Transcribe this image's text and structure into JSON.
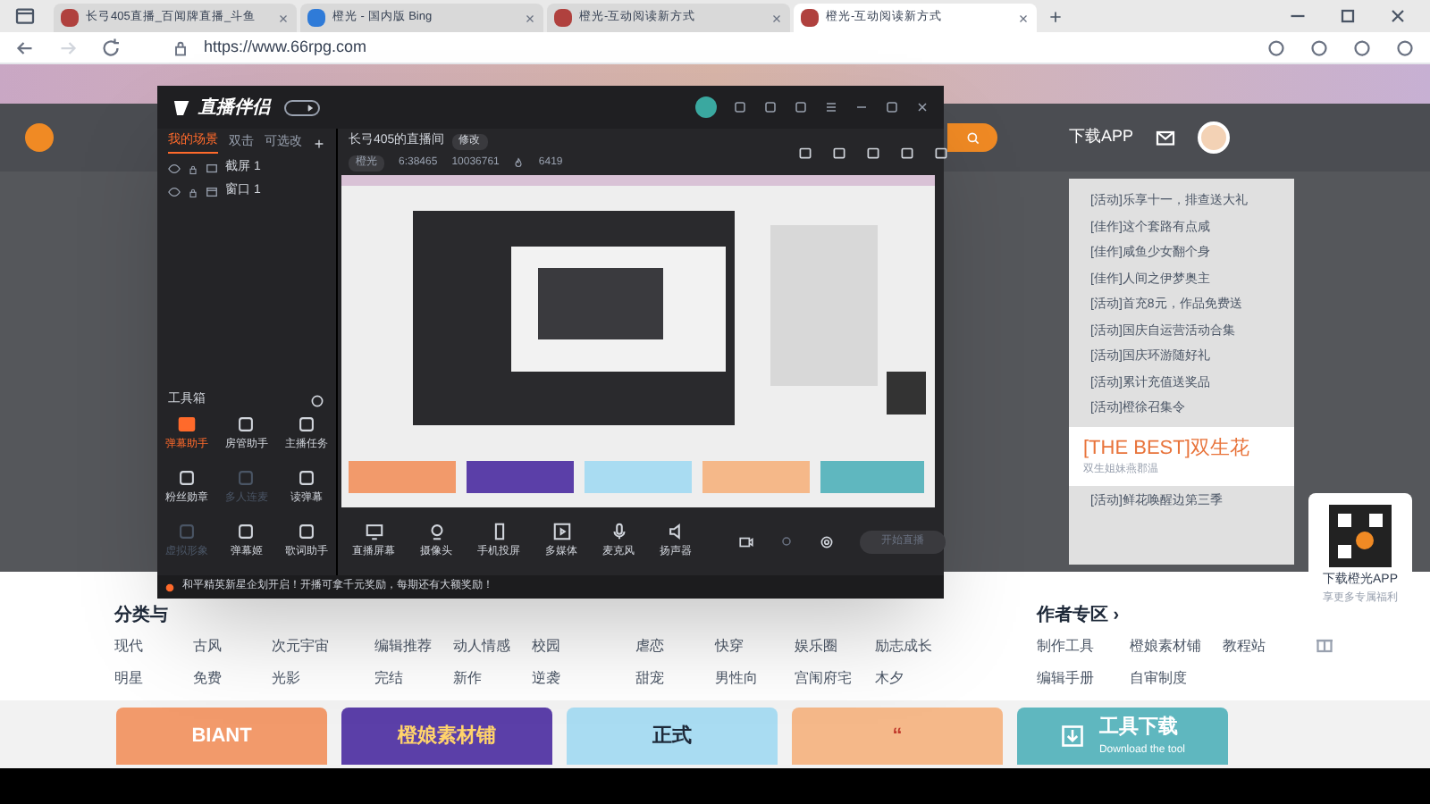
{
  "browser": {
    "tabs": [
      {
        "title": "长弓405直播_百闻牌直播_斗鱼",
        "selected": false
      },
      {
        "title": "橙光 - 国内版 Bing",
        "selected": false
      },
      {
        "title": "橙光-互动阅读新方式",
        "selected": false
      },
      {
        "title": "橙光-互动阅读新方式",
        "selected": true
      }
    ],
    "address": "https://www.66rpg.com"
  },
  "site": {
    "header": {
      "download_app": "下载APP"
    },
    "news": [
      {
        "text": "[活动]乐享十一，排查送大礼",
        "highlight": false
      },
      {
        "text": "[佳作]这个套路有点咸",
        "highlight": false
      },
      {
        "text": "[佳作]咸鱼少女翻个身",
        "highlight": false
      },
      {
        "text": "[佳作]人间之伊梦奥主",
        "highlight": false
      },
      {
        "text": "[活动]首充8元，作品免费送",
        "highlight": false
      },
      {
        "text": "[活动]国庆自运营活动合集",
        "highlight": false
      },
      {
        "text": "[活动]国庆环游随好礼",
        "highlight": false
      },
      {
        "text": "[活动]累计充值送奖品",
        "highlight": false
      },
      {
        "text": "[活动]橙徐召集令",
        "highlight": false
      },
      {
        "text": "[THE BEST]双生花",
        "subtitle": "双生姐妹燕郡温",
        "highlight": true
      },
      {
        "text": "[活动]鲜花唤醒边第三季",
        "highlight": false
      }
    ],
    "qr": {
      "title": "下载橙光APP",
      "subtitle": "享更多专属福利"
    },
    "categories": {
      "title": "分类与",
      "groups": [
        [
          "现代",
          "古风",
          "次元宇宙",
          "明星",
          "免费",
          "光影"
        ],
        [
          "编辑推荐",
          "动人情感",
          "校园",
          "完结",
          "新作",
          "逆袭"
        ],
        [
          "虐恋",
          "快穿",
          "娱乐圈",
          "励志成长",
          "甜宠",
          "男性向",
          "宫闱府宅",
          "木夕"
        ]
      ]
    },
    "author_zone": {
      "title": "作者专区 ›",
      "links": [
        "制作工具",
        "橙娘素材铺",
        "教程站",
        "编辑手册",
        "自审制度"
      ]
    },
    "banners": [
      {
        "kind": "orange",
        "text": "BIANT"
      },
      {
        "kind": "purple",
        "text": "橙娘素材铺"
      },
      {
        "kind": "blue",
        "text": "正式"
      },
      {
        "kind": "peach",
        "text": "“"
      },
      {
        "kind": "teal",
        "text": "工具下载",
        "subtitle": "Download the tool"
      }
    ]
  },
  "app": {
    "logo": "直播伴侣",
    "scene_tabs": [
      {
        "label": "我的场景",
        "selected": true
      },
      {
        "label": "双击",
        "selected": false
      },
      {
        "label": "可选改",
        "selected": false
      }
    ],
    "sources": [
      {
        "label": "截屏 1",
        "kind": "screen"
      },
      {
        "label": "窗口 1",
        "kind": "window"
      }
    ],
    "toolbox_title": "工具箱",
    "tools": [
      {
        "label": "弹幕助手",
        "selected": true,
        "disabled": false
      },
      {
        "label": "房管助手",
        "selected": false,
        "disabled": false
      },
      {
        "label": "主播任务",
        "selected": false,
        "disabled": false
      },
      {
        "label": "粉丝勋章",
        "selected": false,
        "disabled": false
      },
      {
        "label": "多人连麦",
        "selected": false,
        "disabled": true
      },
      {
        "label": "读弹幕",
        "selected": false,
        "disabled": false
      },
      {
        "label": "虚拟形象",
        "selected": false,
        "disabled": true
      },
      {
        "label": "弹幕姬",
        "selected": false,
        "disabled": false
      },
      {
        "label": "歌词助手",
        "selected": false,
        "disabled": false
      }
    ],
    "room": {
      "title": "长弓405的直播间",
      "edit": "修改",
      "category": "橙光",
      "stats": [
        "6:38465",
        "10036761",
        "6419"
      ]
    },
    "controls": [
      {
        "label": "直播屏幕",
        "kind": "screen"
      },
      {
        "label": "摄像头",
        "kind": "camera"
      },
      {
        "label": "手机投屏",
        "kind": "phone"
      },
      {
        "label": "多媒体",
        "kind": "media"
      },
      {
        "label": "麦克风",
        "kind": "mic"
      },
      {
        "label": "扬声器",
        "kind": "speaker"
      }
    ],
    "start_button": {
      "label": "开始直播",
      "disabled": true
    },
    "notice": "和平精英新星企划开启！开播可拿千元奖励，每期还有大额奖励！"
  }
}
